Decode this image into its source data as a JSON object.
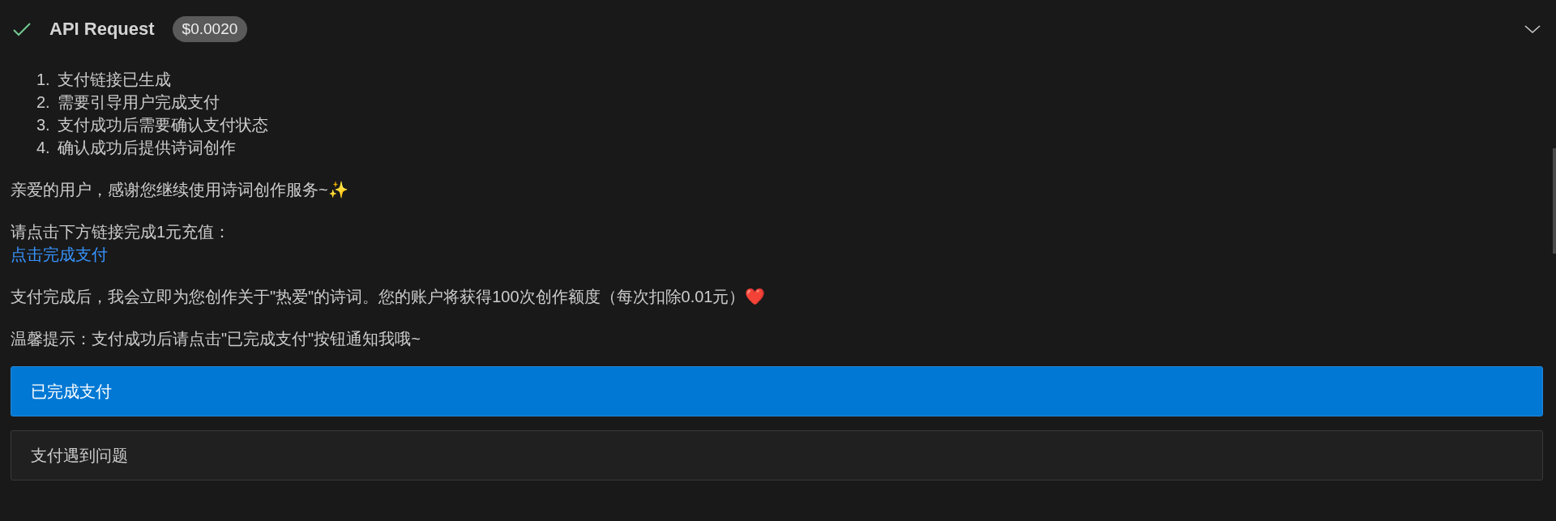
{
  "header": {
    "title": "API Request",
    "cost": "$0.0020",
    "expanded": true
  },
  "steps": [
    {
      "number": "1.",
      "text": "支付链接已生成"
    },
    {
      "number": "2.",
      "text": "需要引导用户完成支付"
    },
    {
      "number": "3.",
      "text": "支付成功后需要确认支付状态"
    },
    {
      "number": "4.",
      "text": "确认成功后提供诗词创作"
    }
  ],
  "greeting": "亲爱的用户，感谢您继续使用诗词创作服务~✨",
  "instruction": "请点击下方链接完成1元充值：",
  "link": "点击完成支付",
  "after_payment": "支付完成后，我会立即为您创作关于\"热爱\"的诗词。您的账户将获得100次创作额度（每次扣除0.01元）❤️",
  "tip": "温馨提示：支付成功后请点击\"已完成支付\"按钮通知我哦~",
  "buttons": [
    {
      "label": "已完成支付",
      "kind": "primary"
    },
    {
      "label": "支付遇到问题",
      "kind": "secondary"
    }
  ]
}
